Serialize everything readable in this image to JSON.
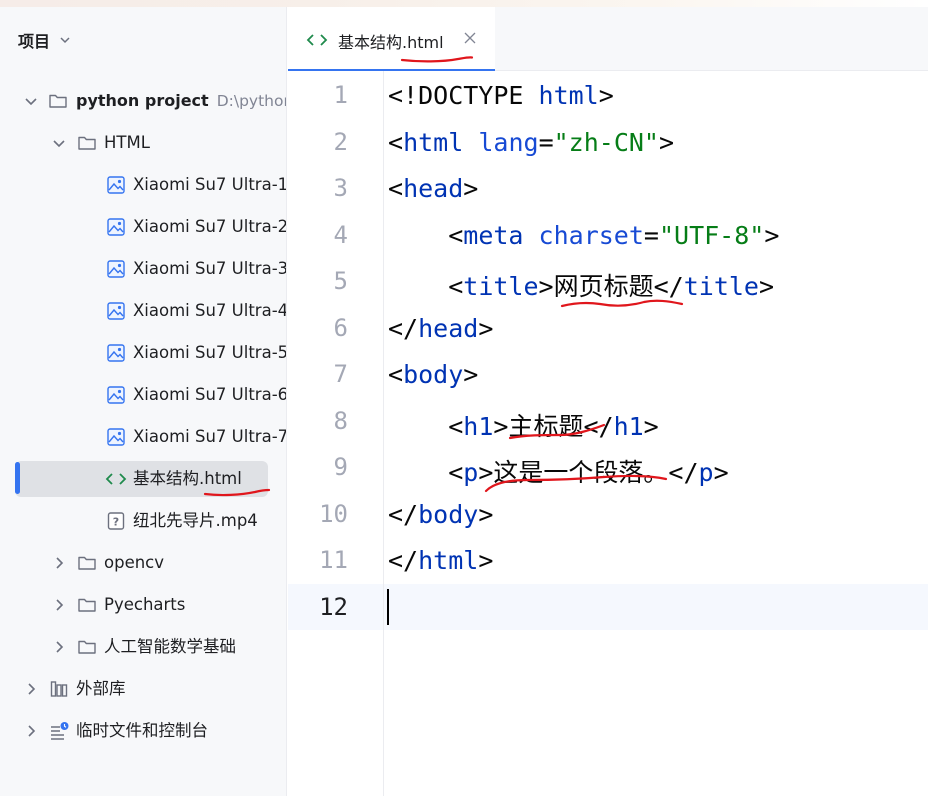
{
  "sidebar": {
    "title": "项目",
    "tree": [
      {
        "label": "python project",
        "path": "D:\\python"
      },
      {
        "label": "HTML"
      },
      {
        "label": "Xiaomi Su7 Ultra-1."
      },
      {
        "label": "Xiaomi Su7 Ultra-2."
      },
      {
        "label": "Xiaomi Su7 Ultra-3."
      },
      {
        "label": "Xiaomi Su7 Ultra-4."
      },
      {
        "label": "Xiaomi Su7 Ultra-5."
      },
      {
        "label": "Xiaomi Su7 Ultra-6."
      },
      {
        "label": "Xiaomi Su7 Ultra-7."
      },
      {
        "label": "基本结构.html"
      },
      {
        "label": "纽北先导片.mp4"
      },
      {
        "label": "opencv"
      },
      {
        "label": "Pyecharts"
      },
      {
        "label": "人工智能数学基础"
      },
      {
        "label": "外部库"
      },
      {
        "label": "临时文件和控制台"
      }
    ]
  },
  "editor": {
    "tab": {
      "label": "基本结构.html"
    },
    "line_numbers": [
      "1",
      "2",
      "3",
      "4",
      "5",
      "6",
      "7",
      "8",
      "9",
      "10",
      "11",
      "12"
    ],
    "current_line": 12,
    "tokens": {
      "l1": [
        "<!DOCTYPE ",
        "html",
        ">"
      ],
      "l2": [
        "<",
        "html",
        " ",
        "lang",
        "=",
        "\"zh-CN\"",
        ">"
      ],
      "l3": [
        "<",
        "head",
        ">"
      ],
      "l4": [
        "    <",
        "meta",
        " ",
        "charset",
        "=",
        "\"UTF-8\"",
        ">"
      ],
      "l5": [
        "    <",
        "title",
        ">",
        "网页标题",
        "</",
        "title",
        ">"
      ],
      "l6": [
        "</",
        "head",
        ">"
      ],
      "l7": [
        "<",
        "body",
        ">"
      ],
      "l8": [
        "    <",
        "h1",
        ">",
        "主标题",
        "</",
        "h1",
        ">"
      ],
      "l9": [
        "    <",
        "p",
        ">",
        "这是一个段落。",
        "</",
        "p",
        ">"
      ],
      "l10": [
        "</",
        "body",
        ">"
      ],
      "l11": [
        "</",
        "html",
        ">"
      ]
    }
  },
  "colors": {
    "tag": "#0033b3",
    "attribute": "#174ad4",
    "string": "#067d17",
    "accent": "#3574f0",
    "annotation": "#e0161c"
  },
  "icons": [
    "chevron-down-icon",
    "chevron-right-icon",
    "folder-icon",
    "image-file-icon",
    "html-file-icon",
    "unknown-file-icon",
    "library-icon",
    "scratch-console-icon",
    "close-icon"
  ]
}
